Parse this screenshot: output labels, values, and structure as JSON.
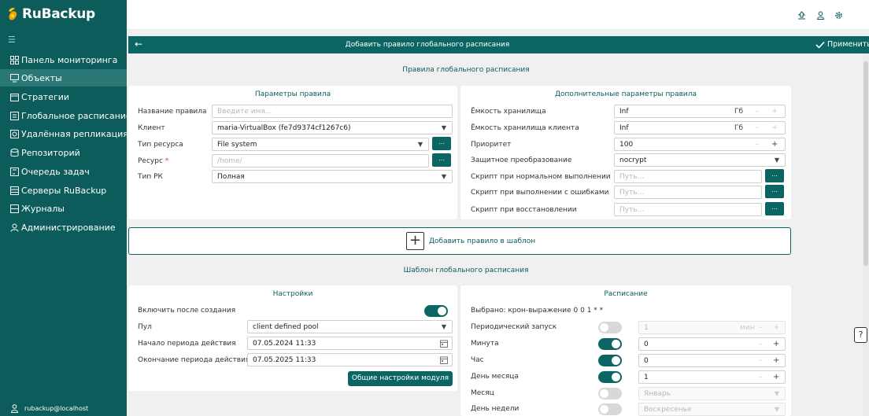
{
  "app": {
    "logo_ru": "Ru",
    "logo_backup": "Backup",
    "user": "rubackup@localhost"
  },
  "sidebar": {
    "items": [
      {
        "label": "Панель мониторинга",
        "icon": "dashboard-icon"
      },
      {
        "label": "Объекты",
        "icon": "monitor-icon",
        "active": true
      },
      {
        "label": "Стратегии",
        "icon": "calendar-icon"
      },
      {
        "label": "Глобальное расписание",
        "icon": "calendar-list-icon"
      },
      {
        "label": "Удалённая репликация",
        "icon": "replication-icon"
      },
      {
        "label": "Репозиторий",
        "icon": "database-icon"
      },
      {
        "label": "Очередь задач",
        "icon": "queue-icon"
      },
      {
        "label": "Серверы RuBackup",
        "icon": "server-icon"
      },
      {
        "label": "Журналы",
        "icon": "journal-icon"
      },
      {
        "label": "Администрирование",
        "icon": "admin-icon"
      }
    ]
  },
  "header": {
    "title": "Добавить правило глобального расписания",
    "apply": "Применить"
  },
  "section1": "Правила глобального расписания",
  "params": {
    "title": "Параметры правила",
    "name_label": "Название правила",
    "name_placeholder": "Введите имя...",
    "client_label": "Клиент",
    "client_value": "maria-VirtualBox (fe7d9374cf1267c6)",
    "type_label": "Тип ресурса",
    "type_value": "File system",
    "resource_label": "Ресурс",
    "resource_required": "*",
    "resource_placeholder": "/home/",
    "rk_label": "Тип РК",
    "rk_value": "Полная"
  },
  "extra": {
    "title": "Дополнительные параметры правила",
    "cap_label": "Ёмкость хранилища",
    "cap_value": "Inf",
    "cap_unit": "Гб",
    "cap_client_label": "Ёмкость хранилища клиента",
    "cap_client_value": "Inf",
    "cap_client_unit": "Гб",
    "prio_label": "Приоритет",
    "prio_value": "100",
    "protect_label": "Защитное преобразование",
    "protect_value": "nocrypt",
    "script_ok_label": "Скрипт при нормальном выполнении",
    "script_ok_placeholder": "Путь...",
    "script_err_label": "Скрипт при выполнении с ошибками",
    "script_err_placeholder": "Путь...",
    "script_restore_label": "Скрипт при восстановлении",
    "script_restore_placeholder": "Путь..."
  },
  "add_rule": "Добавить правило в шаблон",
  "section2": "Шаблон глобального расписания",
  "settings": {
    "title": "Настройки",
    "enable_label": "Включить после создания",
    "pool_label": "Пул",
    "pool_value": "client defined pool",
    "start_label": "Начало периода действия",
    "start_value": "07.05.2024 11:33",
    "end_label": "Окончание периода действия",
    "end_value": "07.05.2025 11:33",
    "module_button": "Общие настройки модуля"
  },
  "schedule": {
    "title": "Расписание",
    "cron": "Выбрано: крон-выражение 0 0 1 * *",
    "periodic_label": "Периодический запуск",
    "periodic_value": "1",
    "periodic_unit": "мин",
    "minute_label": "Минута",
    "minute_value": "0",
    "hour_label": "Час",
    "hour_value": "0",
    "day_label": "День месяца",
    "day_value": "1",
    "month_label": "Месяц",
    "month_value": "Январь",
    "weekday_label": "День недели",
    "weekday_value": "Воскресенье"
  },
  "plus_sign": "+",
  "minus_sign": "–",
  "dots": "...",
  "help": "?"
}
